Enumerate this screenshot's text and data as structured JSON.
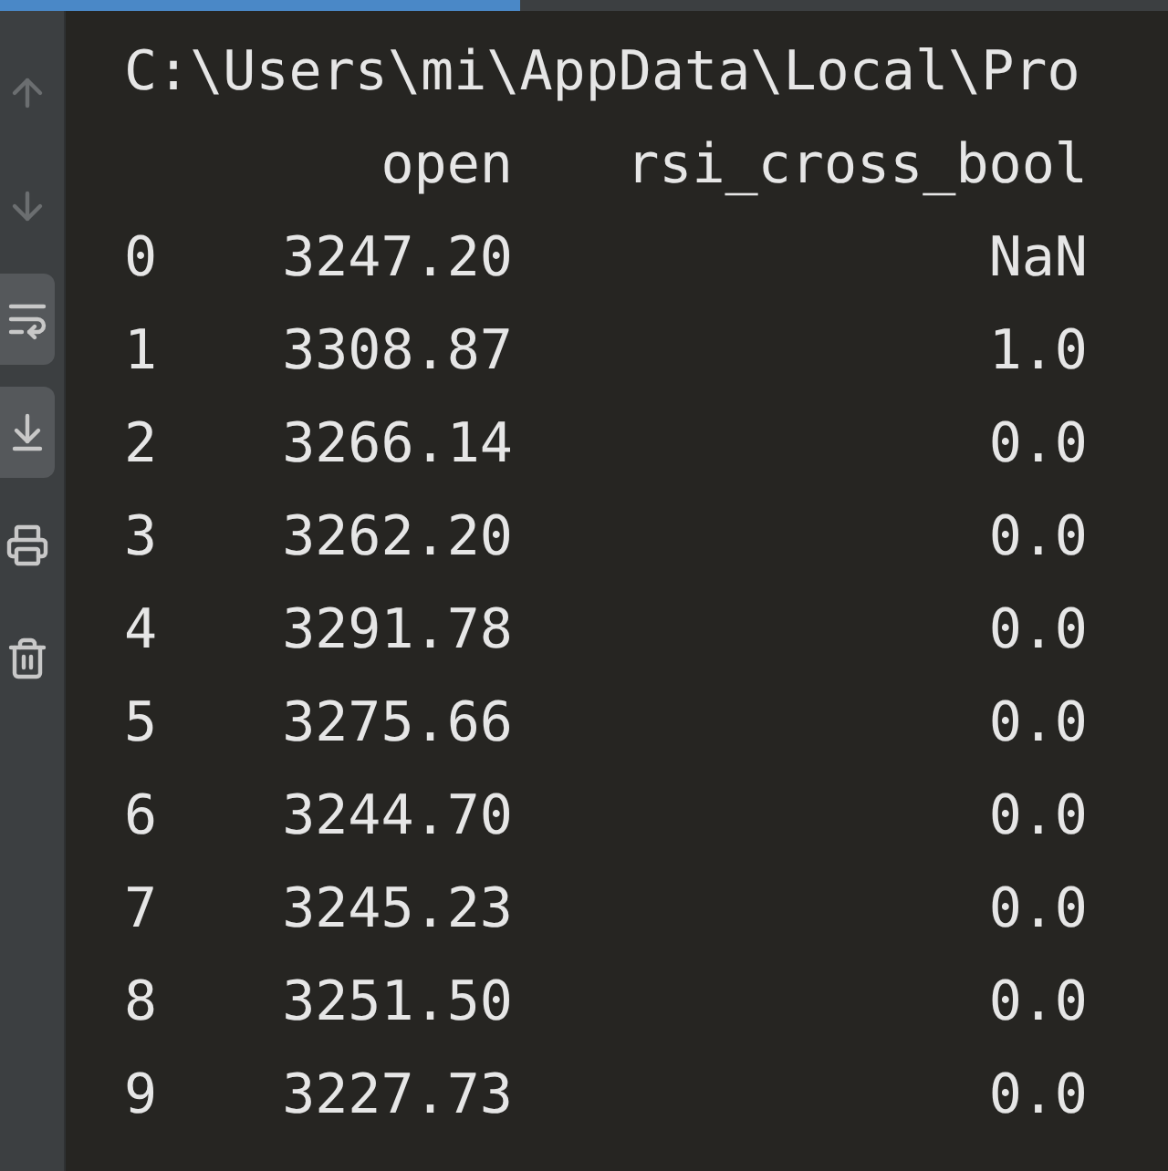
{
  "toolbar": [
    {
      "kind": "up",
      "disabled": true
    },
    {
      "kind": "down",
      "disabled": true
    },
    {
      "kind": "wrap",
      "on": true
    },
    {
      "kind": "scroll-end",
      "on": true
    },
    {
      "kind": "print",
      "on": false
    },
    {
      "kind": "trash",
      "on": false
    }
  ],
  "console": {
    "path": "C:\\Users\\mi\\AppData\\Local\\Pro",
    "columns": [
      "",
      "open",
      "rsi_cross_bool"
    ],
    "rows": [
      [
        "0",
        "3247.20",
        "NaN"
      ],
      [
        "1",
        "3308.87",
        "1.0"
      ],
      [
        "2",
        "3266.14",
        "0.0"
      ],
      [
        "3",
        "3262.20",
        "0.0"
      ],
      [
        "4",
        "3291.78",
        "0.0"
      ],
      [
        "5",
        "3275.66",
        "0.0"
      ],
      [
        "6",
        "3244.70",
        "0.0"
      ],
      [
        "7",
        "3245.23",
        "0.0"
      ],
      [
        "8",
        "3251.50",
        "0.0"
      ],
      [
        "9",
        "3227.73",
        "0.0"
      ]
    ]
  }
}
